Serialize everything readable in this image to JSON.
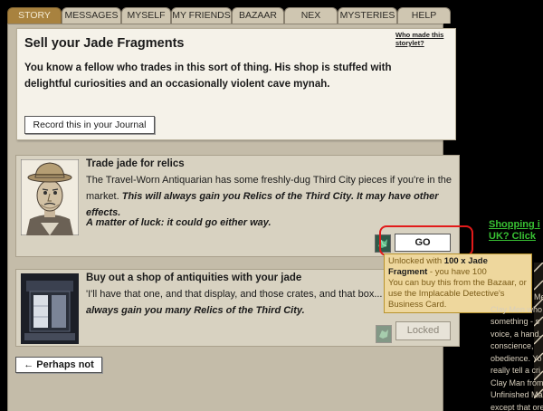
{
  "tabs": [
    "STORY",
    "MESSAGES",
    "MYSELF",
    "MY FRIENDS",
    "BAZAAR",
    "NEX",
    "MYSTERIES",
    "HELP"
  ],
  "storylet": {
    "title": "Sell your Jade Fragments",
    "who_made": "Who made this storylet?",
    "description": "You know a fellow who trades in this sort of thing. His shop is stuffed with delightful curiosities and an occasionally violent cave mynah.",
    "journal_button": "Record this in your Journal"
  },
  "branch1": {
    "title": "Trade jade for relics",
    "desc_plain": "The Travel-Worn Antiquarian has some freshly-dug Third City pieces if you're in the market. ",
    "desc_bold": "This will always gain you Relics of the Third City. It may have other effects.",
    "luck": "A matter of luck: it could go either way.",
    "button": "GO"
  },
  "branch2": {
    "title": "Buy out a shop of antiquities with your jade",
    "desc_line1": "'I'll have that one, and that display, and those crates, and that box...",
    "desc_line2": "always gain you many Relics of the Third City.",
    "button": "Locked"
  },
  "tooltip": {
    "line1_pre": "Unlocked with ",
    "line1_bold": "100 x Jade Fragment",
    "line1_post": " - you have 100",
    "line2": "You can buy this from the Bazaar, or use the Implacable Detective's Business Card."
  },
  "perhaps_not": "← Perhaps not",
  "shopping_link": [
    "Shopping i",
    "UK? Click"
  ],
  "side_text": [
    "Me",
    "Clay Men who",
    "something - s",
    "voice, a hand,",
    "conscience,",
    "obedience. Yo",
    "really tell a cri",
    "Clay Man from",
    "Unfinished Ma",
    "except that ore"
  ],
  "colors": {
    "tab_active": "#a8823f",
    "panel": "#c4bca9",
    "link_green": "#38c133",
    "tooltip_bg": "#eed79d",
    "highlight": "#e21a1a"
  },
  "icons": {
    "jade": "jade-fragment-icon",
    "arrow": "left-arrow-icon"
  }
}
